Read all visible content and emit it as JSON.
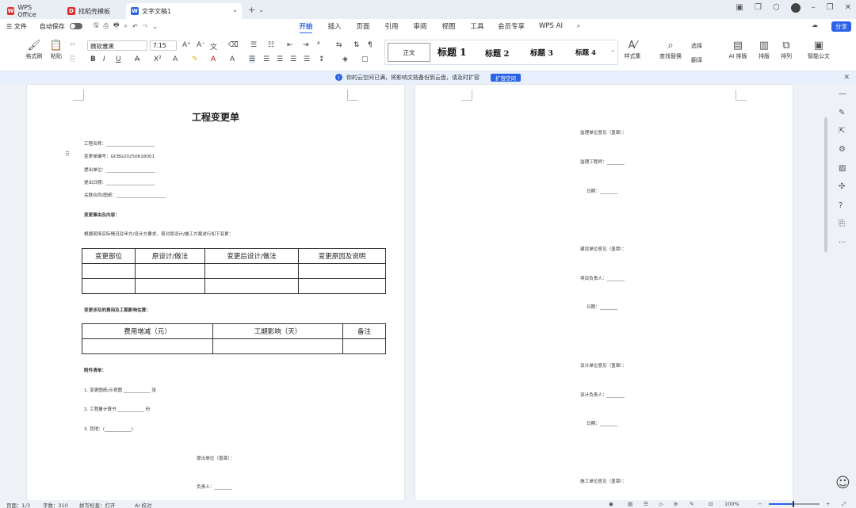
{
  "app": {
    "tabs": [
      {
        "label": "WPS Office",
        "icon": "wps-logo-icon",
        "color": "#e02d2d"
      },
      {
        "label": "找稻壳模板",
        "icon": "docer-icon",
        "color": "#e02d2d"
      },
      {
        "label": "文字文稿1",
        "icon": "writer-doc-icon",
        "color": "#2c62e8"
      }
    ],
    "new_tab": "+",
    "tab_menu": "⌄"
  },
  "menubar": {
    "file": "☰ 文件",
    "autosave": "自动保存",
    "tabs": [
      "开始",
      "插入",
      "页面",
      "引用",
      "审阅",
      "视图",
      "工具",
      "会员专享",
      "WPS AI"
    ],
    "active_tab": "开始",
    "share": "分享"
  },
  "ribbon": {
    "format_painter": "格式刷",
    "paste": "粘贴",
    "font_name": "微软雅黑",
    "font_size": "7.15",
    "styles": {
      "normal": "正文",
      "h1": "标题 1",
      "h2": "标题 2",
      "h3": "标题 3",
      "h4": "标题 4"
    },
    "style_set": "样式集",
    "find_replace": "查找替换",
    "select": "选择",
    "translate": "翻译",
    "ai_layout": "AI 排版",
    "layout": "排版",
    "arrange": "排列",
    "smart_doc": "智能公文"
  },
  "notification": {
    "text": "你的云空间已满，将影响文档备份到云盘，请及时扩容",
    "button": "扩容空间"
  },
  "doc_page1": {
    "title": "工程变更单",
    "fields": [
      "工程名称：______________________",
      "变更单编号：GCBG20250618001",
      "提出单位：______________________",
      "提出日期：______________________",
      "关联合同/图纸：______________________"
    ],
    "section1": "变更事由及内容：",
    "section1_text": "根据现场实际情况及甲方/设计方要求，现对原设计/施工方案进行如下变更：",
    "table1_headers": [
      "变更部位",
      "原设计/做法",
      "变更后设计/做法",
      "变更原因及说明"
    ],
    "section2": "变更涉及的费用及工期影响估算：",
    "table2_headers": [
      "费用增减（元）",
      "工期影响（天）",
      "备注"
    ],
    "section3": "附件清单：",
    "attachments": [
      "1. 变更图纸/示意图 ____________ 张",
      "2. 工程量计算书 ____________ 份",
      "3. 其他：(____________)"
    ],
    "sign1": "提出单位（盖章）：",
    "sign2": "负责人：________"
  },
  "doc_page2": {
    "lines": [
      "监理单位意见（盖章）：",
      "监理工程师：________",
      "日期：________",
      "建设单位意见（盖章）：",
      "项目负责人：________",
      "日期：________",
      "设计单位意见（盖章）：",
      "设计负责人：________",
      "日期：________",
      "施工单位意见（盖章）："
    ]
  },
  "status": {
    "page": "页面：1/3",
    "words": "字数：310",
    "spell": "拼写检查：打开",
    "ai_proof": "AI 校对",
    "zoom": "100%",
    "zoom_level": 0.47
  }
}
